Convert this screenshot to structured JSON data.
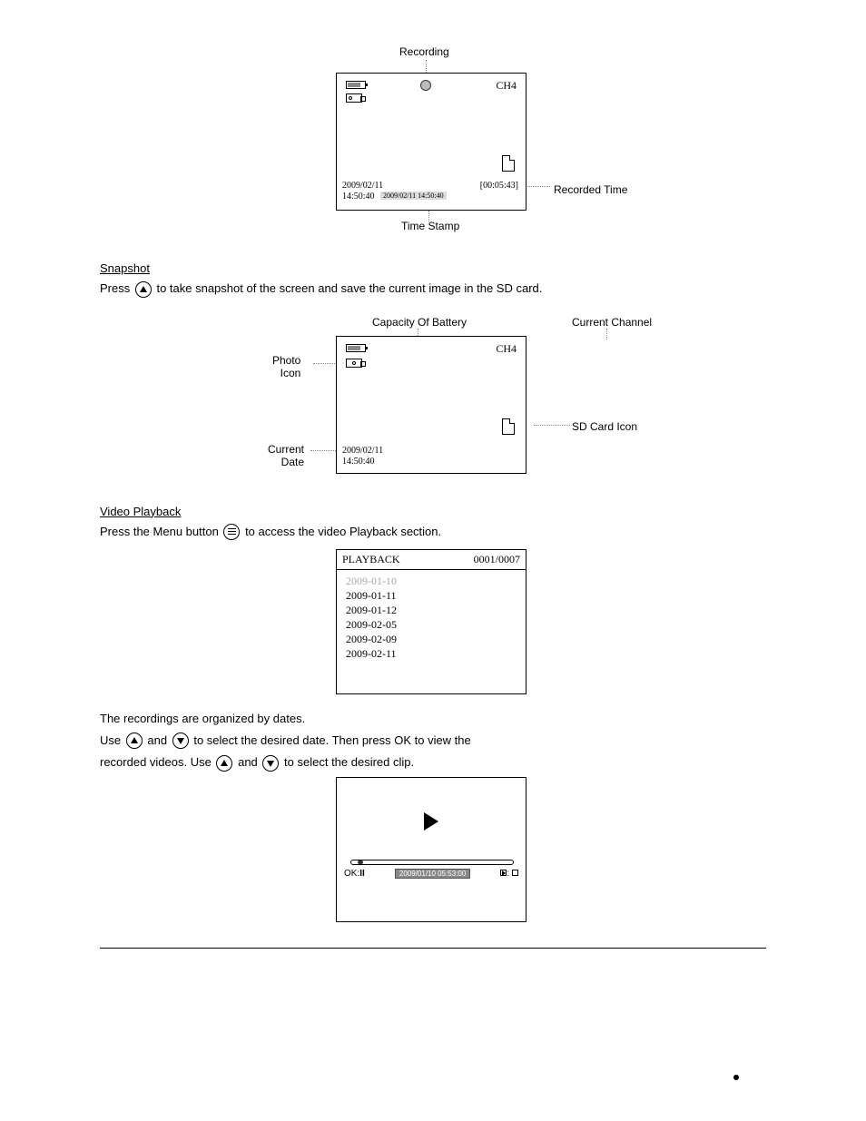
{
  "diagram1": {
    "label_recording": "Recording",
    "label_recorded_time": "Recorded Time",
    "label_time_stamp": "Time Stamp",
    "channel": "CH4",
    "date": "2009/02/11",
    "time": "14:50:40",
    "recorded_duration": "[00:05:43]",
    "stamp_text": "2009/02/11  14:50:40"
  },
  "section2": {
    "heading": "Snapshot",
    "text": "Press        to take snapshot of the screen and save the current image in the SD card."
  },
  "diagram2": {
    "label_battery": "Capacity Of Battery",
    "label_channel": "Current Channel",
    "label_photo": "Photo\nIcon",
    "label_date": "Current\nDate",
    "label_sd": "SD Card Icon",
    "channel": "CH4",
    "date": "2009/02/11",
    "time": "14:50:40"
  },
  "section3": {
    "heading": "Video Playback",
    "line1_a": "Press the Menu button",
    "line1_b": "to access the video Playback section.",
    "line2": "The recordings are organized by dates.",
    "line3_a": "Use",
    "line3_b": "and",
    "line3_c": "to select the desired date. Then press OK to view the",
    "line4_a": "recorded videos. Use",
    "line4_b": "and",
    "line4_c": "to select the desired clip."
  },
  "diagram3": {
    "title": "PLAYBACK",
    "counter": "0001/0007",
    "items": [
      "2009-01-10",
      "2009-01-11",
      "2009-01-12",
      "2009-02-05",
      "2009-02-09",
      "2009-02-11"
    ]
  },
  "diagram4": {
    "ok_label": "OK:",
    "ts_chip": "2009/01/10    05:53:00"
  }
}
